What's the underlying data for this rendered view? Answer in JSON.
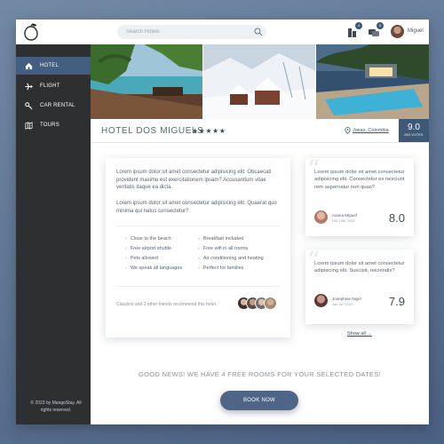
{
  "search": {
    "placeholder": "Search Hotels"
  },
  "header": {
    "user_name": "Miguel",
    "notifications": [
      {
        "icon": "building-icon",
        "count": "4"
      },
      {
        "icon": "messages-icon",
        "count": "5"
      }
    ]
  },
  "sidebar": {
    "items": [
      {
        "label": "HOTEL",
        "icon": "home-icon",
        "active": true
      },
      {
        "label": "FLIGHT",
        "icon": "airplane-icon",
        "active": false
      },
      {
        "label": "CAR RENTAL",
        "icon": "key-icon",
        "active": false
      },
      {
        "label": "TOURS",
        "icon": "map-icon",
        "active": false
      }
    ],
    "copyright": "© 2023 by MangoStay. All rights reserved."
  },
  "hotel": {
    "name": "HOTEL DOS MIGUELS",
    "stars": "★★★★★",
    "location": "Josas, Colombia",
    "score": "9.0",
    "score_label": "260 VOTES"
  },
  "description": {
    "p1": "Lorem ipsum dolor sit amet consectetur adipisicing elit. Obcaecati provident maxime est exercitationem ipsam? Accusantium vitae veritatis itaque ea dicta.",
    "p2": "Lorem ipsum dolor sit amet consectetur adipisicing elit. Quaerat quo minima qui natus consectetur?"
  },
  "amenities": {
    "col1": [
      "Close to the beach",
      "Free airport shuttle",
      "Pets allowed",
      "We speak all languages"
    ],
    "col2": [
      "Breakfast included",
      "Free wifi in all rooms",
      "Air conditioning and heating",
      "Perfect for families"
    ]
  },
  "friends": {
    "text": "Claudios and 3 other friends recommend this hotel."
  },
  "reviews": [
    {
      "text": "Lorem ipsum dolor sit amet consectetur adipisicing elit. Consectetur ex nesciunt rem aspernatur non quas?",
      "name": "Asana Miguel",
      "date": "Feb 19th, 2023",
      "score": "8.0"
    },
    {
      "text": "Lorem ipsum dolor sit amet consectetur adipisicing elit. Suscipit, reiciendis?",
      "name": "Josephine Nigel",
      "date": "Jan 1st, 2023",
      "score": "7.9"
    }
  ],
  "show_all": "Show all →",
  "cta": {
    "message": "GOOD NEWS! WE HAVE 4 FREE ROOMS FOR YOUR SELECTED DATES!",
    "button": "BOOK NOW"
  },
  "colors": {
    "accent": "#3e5878",
    "sidebar": "#2e2f31",
    "active_nav": "#435e80"
  }
}
